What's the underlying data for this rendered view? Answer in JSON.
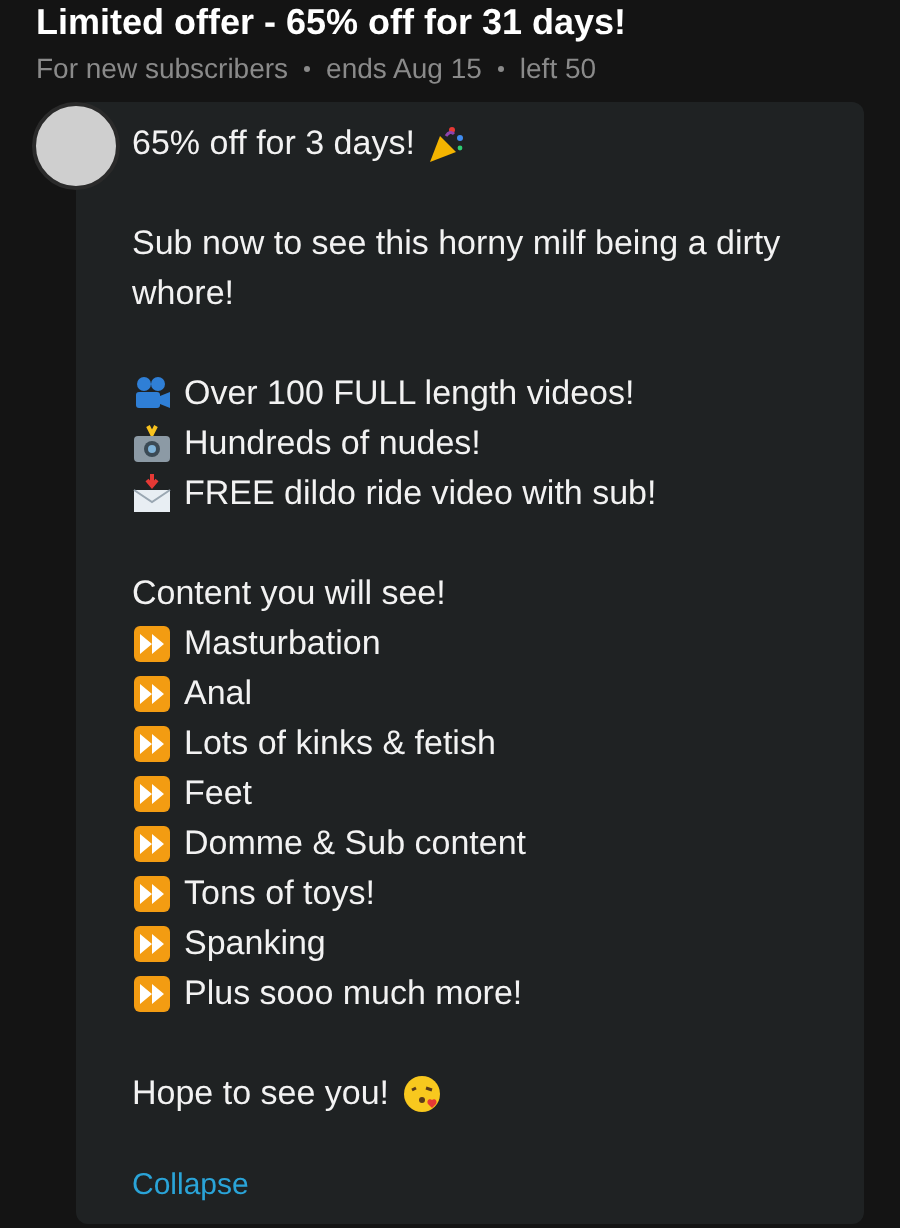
{
  "offer": {
    "title": "Limited offer - 65% off for 31 days!",
    "meta": [
      "For new subscribers",
      "ends Aug 15",
      "left 50"
    ]
  },
  "post": {
    "paragraphs": [
      [
        {
          "kind": "party",
          "text": "65% off for 3 days!"
        }
      ],
      [
        {
          "kind": "plain",
          "text": "Sub now to see this horny milf being a dirty whore!"
        }
      ],
      [
        {
          "kind": "video",
          "text": "Over 100 FULL length videos!"
        },
        {
          "kind": "camera",
          "text": "Hundreds of nudes!"
        },
        {
          "kind": "mail",
          "text": "FREE dildo ride video with sub!"
        }
      ],
      [
        {
          "kind": "plain",
          "text": "Content you will see!"
        },
        {
          "kind": "ff",
          "text": "Masturbation"
        },
        {
          "kind": "ff",
          "text": "Anal"
        },
        {
          "kind": "ff",
          "text": "Lots of kinks & fetish"
        },
        {
          "kind": "ff",
          "text": "Feet"
        },
        {
          "kind": "ff",
          "text": "Domme & Sub content"
        },
        {
          "kind": "ff",
          "text": "Tons of toys!"
        },
        {
          "kind": "ff",
          "text": "Spanking"
        },
        {
          "kind": "ff",
          "text": "Plus sooo much more!"
        }
      ],
      [
        {
          "kind": "kiss",
          "text": "Hope to see you!"
        }
      ]
    ],
    "collapse": "Collapse"
  }
}
